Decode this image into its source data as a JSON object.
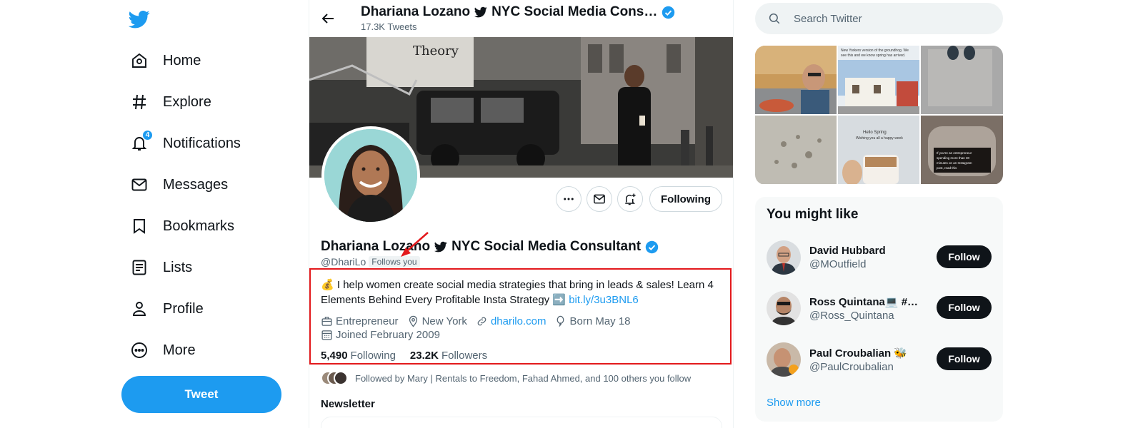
{
  "nav": {
    "items": [
      {
        "label": "Home",
        "icon": "home-icon"
      },
      {
        "label": "Explore",
        "icon": "hashtag-icon"
      },
      {
        "label": "Notifications",
        "icon": "bell-icon",
        "badge": "4"
      },
      {
        "label": "Messages",
        "icon": "envelope-icon"
      },
      {
        "label": "Bookmarks",
        "icon": "bookmark-icon"
      },
      {
        "label": "Lists",
        "icon": "list-icon"
      },
      {
        "label": "Profile",
        "icon": "person-icon"
      },
      {
        "label": "More",
        "icon": "more-circle-icon"
      }
    ],
    "tweet_label": "Tweet"
  },
  "header": {
    "name": "Dhariana Lozano",
    "name_suffix": "NYC Social Media Cons…",
    "tweet_count": "17.3K Tweets"
  },
  "profile": {
    "name": "Dhariana Lozano",
    "name_suffix": "NYC Social Media Consultant",
    "handle": "@DhariLo",
    "follows_you": "Follows you",
    "bio_emoji": "💰",
    "bio_text": "I help women create social media strategies that bring in leads & sales! Learn 4 Elements Behind Every Profitable Insta Strategy",
    "bio_arrow": "➡️",
    "bio_link": "bit.ly/3u3BNL6",
    "category": "Entrepreneur",
    "location": "New York",
    "website": "dharilo.com",
    "birthday": "Born May 18",
    "joined": "Joined February 2009",
    "following_count": "5,490",
    "following_label": "Following",
    "followers_count": "23.2K",
    "followers_label": "Followers",
    "followed_by": "Followed by Mary | Rentals to Freedom, Fahad Ahmed, and 100 others you follow",
    "newsletter_label": "Newsletter",
    "following_button": "Following"
  },
  "search": {
    "placeholder": "Search Twitter"
  },
  "banner_text": "Theory",
  "media_tiles": [
    {
      "text": ""
    },
    {
      "text": "New Yorkers version of the groundhog. We see this and we know spring has arrived."
    },
    {
      "text": ""
    },
    {
      "text": ""
    },
    {
      "text": "Hello Spring\nWishing you all a happy week"
    },
    {
      "text": "If you're an entrepreneur spending more than 30 minutes on an Instagram post, read this"
    }
  ],
  "who_to_follow": {
    "title": "You might like",
    "users": [
      {
        "name": "David Hubbard",
        "handle": "@MOutfield",
        "button": "Follow"
      },
      {
        "name": "Ross Quintana💻 #A…",
        "handle": "@Ross_Quintana",
        "button": "Follow"
      },
      {
        "name": "Paul Croubalian 🐝",
        "handle": "@PaulCroubalian",
        "button": "Follow"
      }
    ],
    "show_more": "Show more"
  },
  "colors": {
    "accent": "#1d9bf0",
    "highlight": "#e3191c",
    "text": "#0f1419",
    "secondary": "#536471"
  }
}
